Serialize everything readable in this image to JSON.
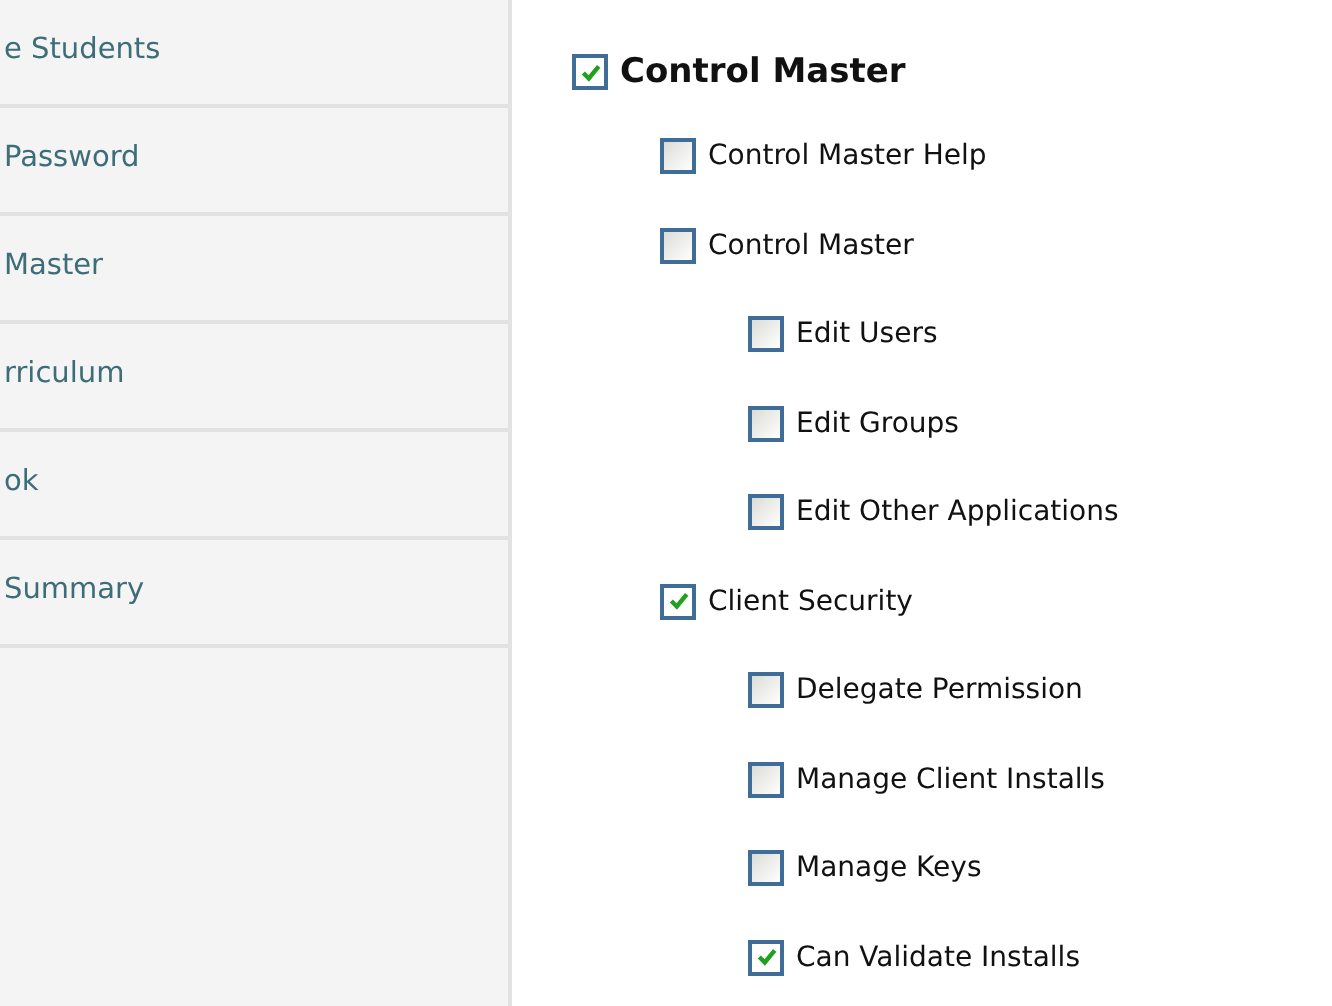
{
  "sidebar": {
    "items": [
      {
        "label": "e Students"
      },
      {
        "label": "Password"
      },
      {
        "label": "Master"
      },
      {
        "label": "rriculum"
      },
      {
        "label": "ok"
      },
      {
        "label": "Summary"
      }
    ]
  },
  "permissions": [
    {
      "label": "Control Master",
      "checked": true,
      "children": [
        {
          "label": "Control Master Help",
          "checked": false
        },
        {
          "label": "Control Master",
          "checked": false,
          "children": [
            {
              "label": "Edit Users",
              "checked": false
            },
            {
              "label": "Edit Groups",
              "checked": false
            },
            {
              "label": "Edit Other Applications",
              "checked": false
            }
          ]
        },
        {
          "label": "Client Security",
          "checked": true,
          "children": [
            {
              "label": "Delegate Permission",
              "checked": false
            },
            {
              "label": "Manage Client Installs",
              "checked": false
            },
            {
              "label": "Manage Keys",
              "checked": false
            },
            {
              "label": "Can Validate Installs",
              "checked": true
            }
          ]
        }
      ]
    }
  ]
}
